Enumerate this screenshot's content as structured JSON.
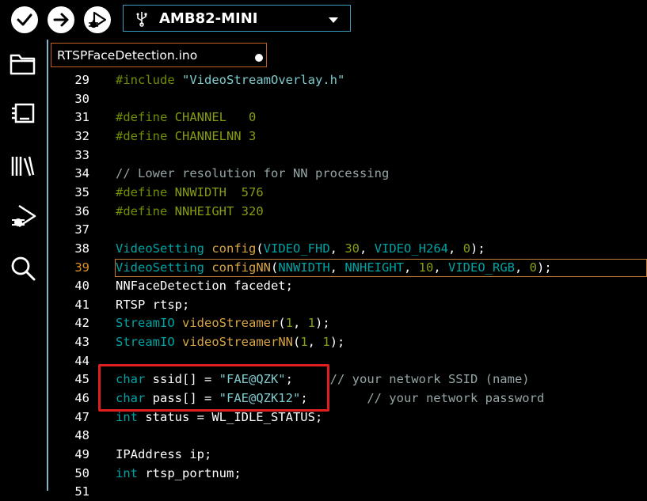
{
  "toolbar": {
    "verify_label": "Verify",
    "upload_label": "Upload",
    "debug_label": "Debug",
    "board_name": "AMB82-MINI"
  },
  "sidebar": {
    "items": [
      "sketchbook",
      "boards-manager",
      "library-manager",
      "debug",
      "search"
    ]
  },
  "tab": {
    "filename": "RTSPFaceDetection.ino"
  },
  "editor": {
    "active_line": "39",
    "lines": [
      {
        "n": "29",
        "tokens": [
          {
            "t": "#include ",
            "c": "pp"
          },
          {
            "t": "\"VideoStreamOverlay.h\"",
            "c": "st"
          }
        ]
      },
      {
        "n": "30",
        "tokens": []
      },
      {
        "n": "31",
        "tokens": [
          {
            "t": "#define ",
            "c": "pp"
          },
          {
            "t": "CHANNEL   ",
            "c": "num"
          },
          {
            "t": "0",
            "c": "num"
          }
        ]
      },
      {
        "n": "32",
        "tokens": [
          {
            "t": "#define ",
            "c": "pp"
          },
          {
            "t": "CHANNELNN ",
            "c": "num"
          },
          {
            "t": "3",
            "c": "num"
          }
        ]
      },
      {
        "n": "33",
        "tokens": []
      },
      {
        "n": "34",
        "tokens": [
          {
            "t": "// Lower resolution for NN processing",
            "c": "cm"
          }
        ]
      },
      {
        "n": "35",
        "tokens": [
          {
            "t": "#define ",
            "c": "pp"
          },
          {
            "t": "NNWIDTH  ",
            "c": "num"
          },
          {
            "t": "576",
            "c": "num"
          }
        ]
      },
      {
        "n": "36",
        "tokens": [
          {
            "t": "#define ",
            "c": "pp"
          },
          {
            "t": "NNHEIGHT ",
            "c": "num"
          },
          {
            "t": "320",
            "c": "num"
          }
        ]
      },
      {
        "n": "37",
        "tokens": []
      },
      {
        "n": "38",
        "tokens": [
          {
            "t": "VideoSetting ",
            "c": "ty"
          },
          {
            "t": "config",
            "c": "fn"
          },
          {
            "t": "(",
            "c": "plain"
          },
          {
            "t": "VIDEO_FHD",
            "c": "ty"
          },
          {
            "t": ", ",
            "c": "plain"
          },
          {
            "t": "30",
            "c": "num"
          },
          {
            "t": ", ",
            "c": "plain"
          },
          {
            "t": "VIDEO_H264",
            "c": "ty"
          },
          {
            "t": ", ",
            "c": "plain"
          },
          {
            "t": "0",
            "c": "num"
          },
          {
            "t": ");",
            "c": "plain"
          }
        ]
      },
      {
        "n": "39",
        "tokens": [
          {
            "t": "VideoSetting ",
            "c": "ty"
          },
          {
            "t": "configNN",
            "c": "fn"
          },
          {
            "t": "(",
            "c": "plain"
          },
          {
            "t": "NNWIDTH",
            "c": "ty"
          },
          {
            "t": ", ",
            "c": "plain"
          },
          {
            "t": "NNHEIGHT",
            "c": "ty"
          },
          {
            "t": ", ",
            "c": "plain"
          },
          {
            "t": "10",
            "c": "num"
          },
          {
            "t": ", ",
            "c": "plain"
          },
          {
            "t": "VIDEO_RGB",
            "c": "ty"
          },
          {
            "t": ", ",
            "c": "plain"
          },
          {
            "t": "0",
            "c": "num"
          },
          {
            "t": ");",
            "c": "plain"
          }
        ]
      },
      {
        "n": "40",
        "tokens": [
          {
            "t": "NNFaceDetection facedet;",
            "c": "plain"
          }
        ]
      },
      {
        "n": "41",
        "tokens": [
          {
            "t": "RTSP rtsp;",
            "c": "plain"
          }
        ]
      },
      {
        "n": "42",
        "tokens": [
          {
            "t": "StreamIO ",
            "c": "ty"
          },
          {
            "t": "videoStreamer",
            "c": "fn"
          },
          {
            "t": "(",
            "c": "plain"
          },
          {
            "t": "1",
            "c": "num"
          },
          {
            "t": ", ",
            "c": "plain"
          },
          {
            "t": "1",
            "c": "num"
          },
          {
            "t": ");",
            "c": "plain"
          }
        ]
      },
      {
        "n": "43",
        "tokens": [
          {
            "t": "StreamIO ",
            "c": "ty"
          },
          {
            "t": "videoStreamerNN",
            "c": "fn"
          },
          {
            "t": "(",
            "c": "plain"
          },
          {
            "t": "1",
            "c": "num"
          },
          {
            "t": ", ",
            "c": "plain"
          },
          {
            "t": "1",
            "c": "num"
          },
          {
            "t": ");",
            "c": "plain"
          }
        ]
      },
      {
        "n": "44",
        "tokens": []
      },
      {
        "n": "45",
        "tokens": [
          {
            "t": "char",
            "c": "kw"
          },
          {
            "t": " ssid[] = ",
            "c": "plain"
          },
          {
            "t": "\"FAE@QZK\"",
            "c": "st"
          },
          {
            "t": ";     ",
            "c": "plain"
          },
          {
            "t": "// your network SSID (name)",
            "c": "cm"
          }
        ]
      },
      {
        "n": "46",
        "tokens": [
          {
            "t": "char",
            "c": "kw"
          },
          {
            "t": " pass[] = ",
            "c": "plain"
          },
          {
            "t": "\"FAE@QZK12\"",
            "c": "st"
          },
          {
            "t": ";        ",
            "c": "plain"
          },
          {
            "t": "// your network password",
            "c": "cm"
          }
        ]
      },
      {
        "n": "47",
        "tokens": [
          {
            "t": "int",
            "c": "kw"
          },
          {
            "t": " status = WL_IDLE_STATUS;",
            "c": "plain"
          }
        ]
      },
      {
        "n": "48",
        "tokens": []
      },
      {
        "n": "49",
        "tokens": [
          {
            "t": "IPAddress ip;",
            "c": "plain"
          }
        ]
      },
      {
        "n": "50",
        "tokens": [
          {
            "t": "int",
            "c": "kw"
          },
          {
            "t": " rtsp_portnum;",
            "c": "plain"
          }
        ]
      },
      {
        "n": "51",
        "tokens": []
      }
    ]
  }
}
